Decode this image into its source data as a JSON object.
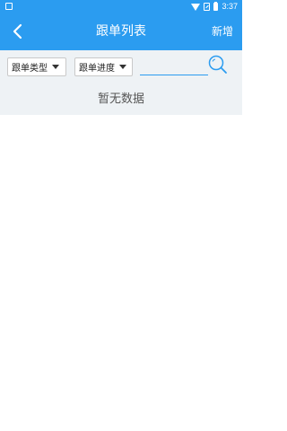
{
  "status_bar": {
    "time": "3:37"
  },
  "app_bar": {
    "title": "跟单列表",
    "action_label": "新增"
  },
  "filters": {
    "type_label": "跟单类型",
    "progress_label": "跟单进度",
    "search_placeholder": ""
  },
  "main": {
    "empty_message": "暂无数据"
  },
  "colors": {
    "primary": "#2b9cf0",
    "filter_bg": "#eef2f5"
  },
  "icons": {
    "back": "chevron-left-icon",
    "search": "search-icon",
    "caret": "caret-down-icon"
  }
}
